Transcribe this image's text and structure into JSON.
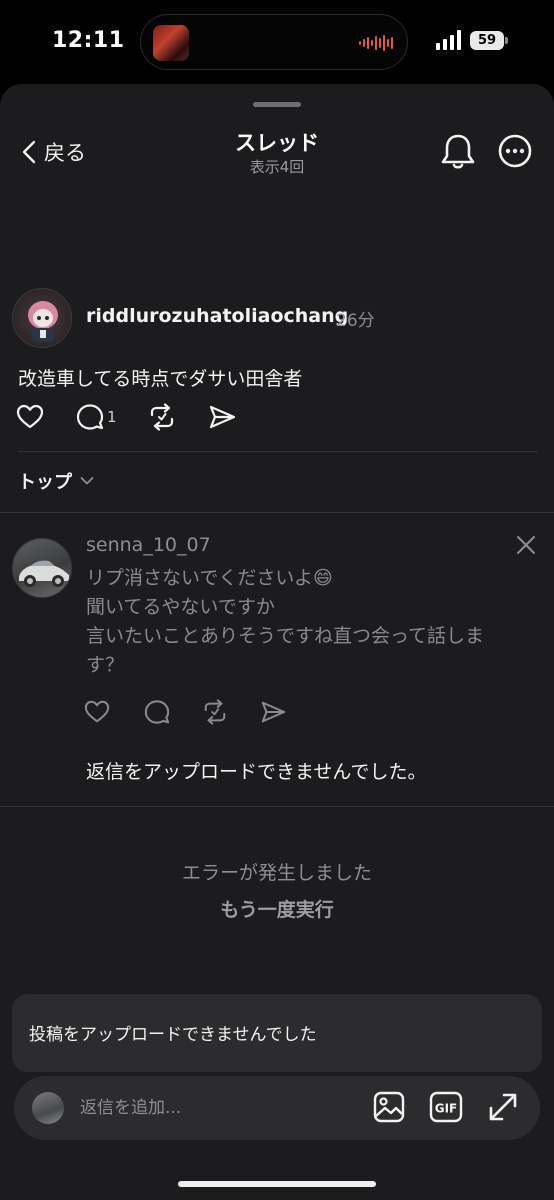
{
  "status_bar": {
    "time": "12:11",
    "battery": "59"
  },
  "header": {
    "back_label": "戻る",
    "title": "スレッド",
    "subtitle": "表示4回"
  },
  "post": {
    "username": "riddlurozuhatoliaochang",
    "time": "26分",
    "text": "改造車してる時点でダサい田舎者",
    "reply_count": "1"
  },
  "sort": {
    "label": "トップ"
  },
  "reply": {
    "username": "senna_10_07",
    "lines": [
      "リプ消さないでくださいよ😄",
      "聞いてるやないですか",
      "言いたいことありそうですね直つ会って話しま",
      "す？"
    ],
    "upload_failed": "返信をアップロードできませんでした。"
  },
  "error": {
    "message": "エラーが発生しました",
    "retry": "もう一度実行"
  },
  "toast": {
    "text": "投稿をアップロードできませんでした"
  },
  "composer": {
    "placeholder": "返信を追加...",
    "gif_label": "GIF"
  },
  "icons": {
    "back": "chevron-left-icon",
    "bell": "bell-icon",
    "more": "more-icon",
    "like": "heart-icon",
    "comment": "comment-icon",
    "repost": "repost-icon",
    "share": "send-icon",
    "close": "close-icon",
    "image": "image-icon",
    "gif": "gif-icon",
    "expand": "expand-icon"
  }
}
